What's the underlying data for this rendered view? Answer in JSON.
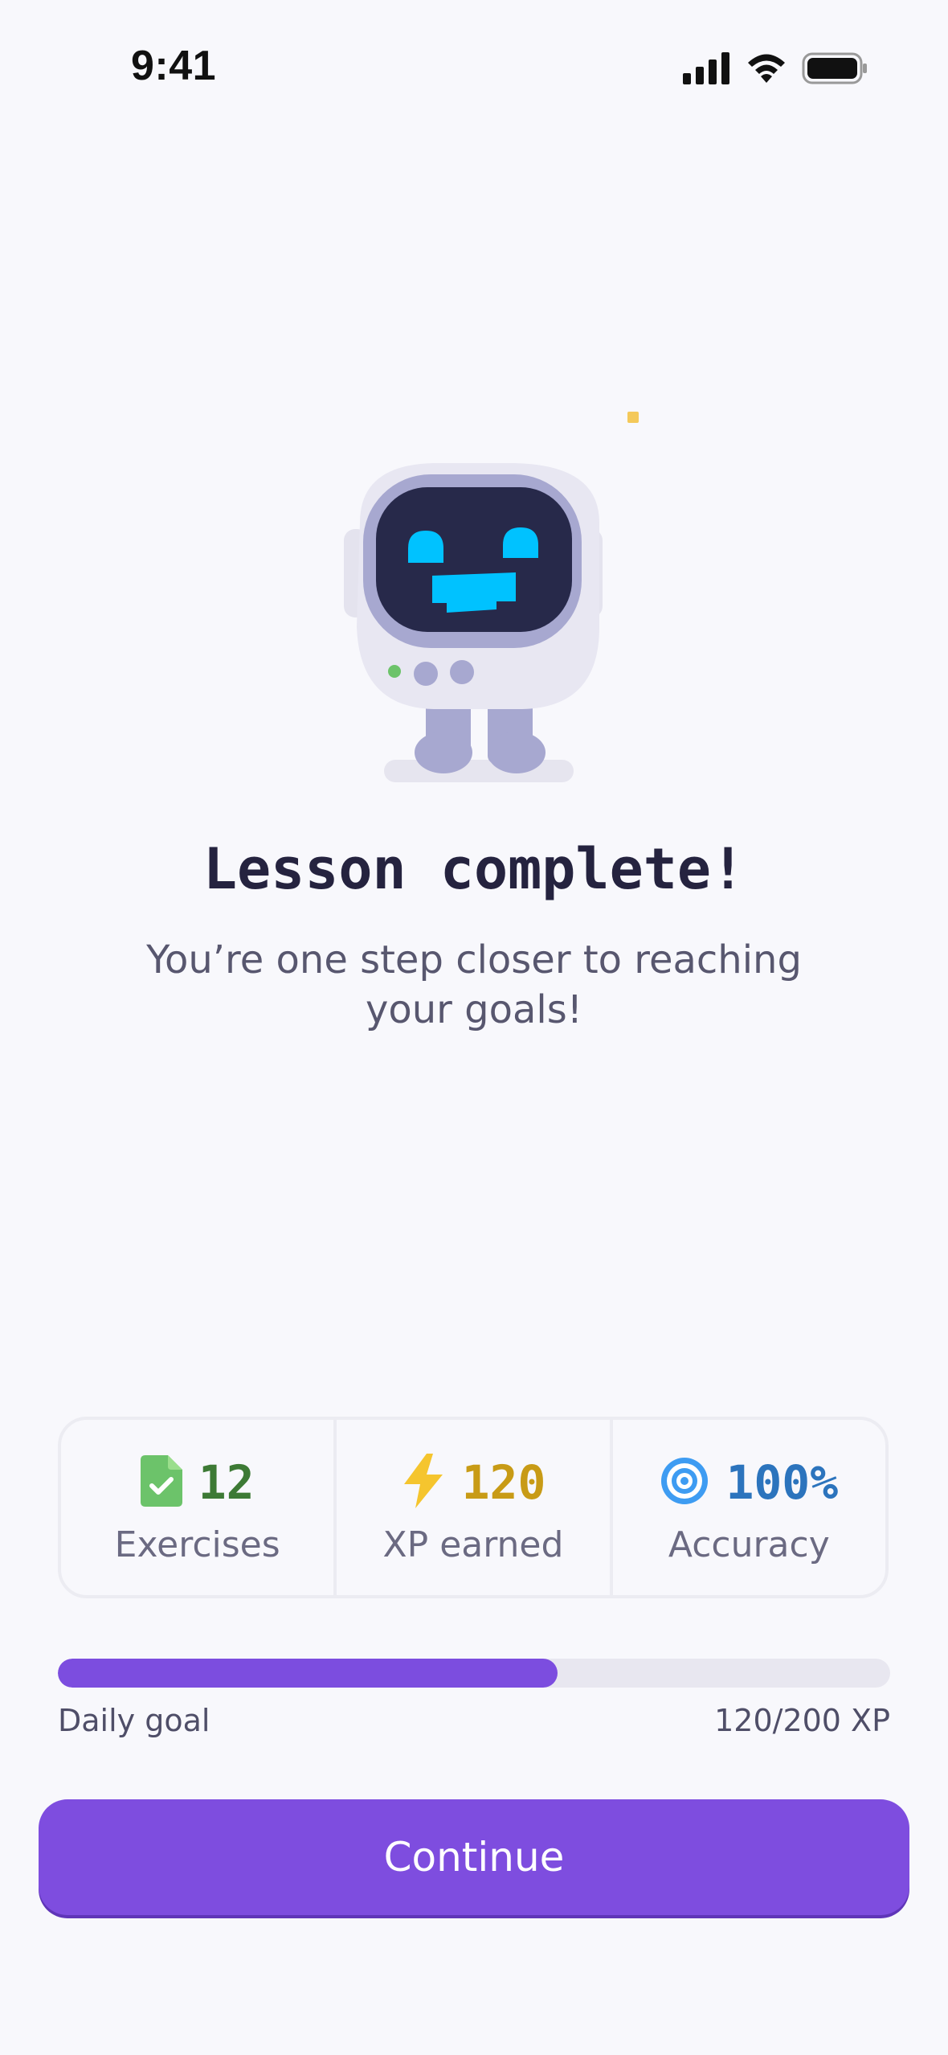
{
  "status_bar": {
    "time": "9:41",
    "icons": [
      "signal-icon",
      "wifi-icon",
      "battery-icon"
    ]
  },
  "hero": {
    "illustration": "robot-mascot",
    "accent_color": "#00C2FF"
  },
  "title": "Lesson complete!",
  "subtitle": "You’re one step closer to reaching your goals!",
  "stats": [
    {
      "icon": "exercise-document-icon",
      "value": "12",
      "label": "Exercises",
      "color": "#3d7a35"
    },
    {
      "icon": "lightning-bolt-icon",
      "value": "120",
      "label": "XP earned",
      "color": "#c89b16"
    },
    {
      "icon": "target-icon",
      "value": "100%",
      "label": "Accuracy",
      "color": "#2c74bd"
    }
  ],
  "daily_goal": {
    "label": "Daily goal",
    "value_text": "120/200 XP",
    "progress": 0.6,
    "bar_color": "#7C4DDF"
  },
  "continue_label": "Continue"
}
